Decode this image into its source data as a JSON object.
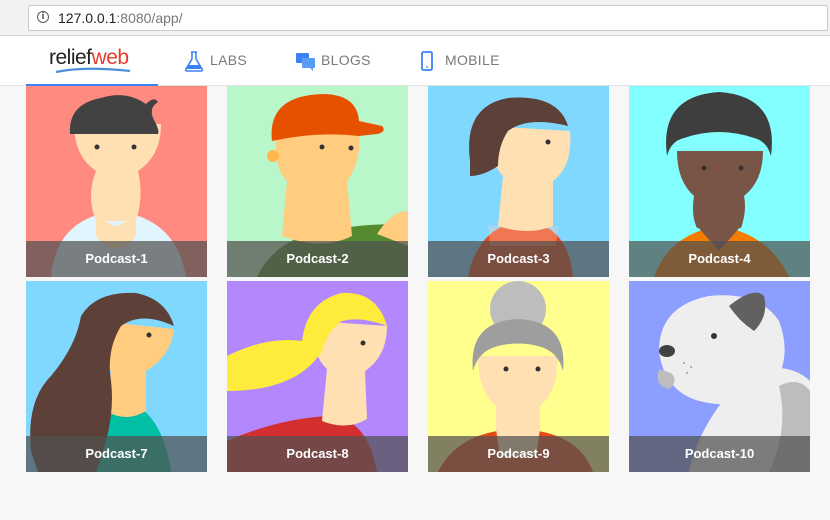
{
  "browser": {
    "url_host": "127.0.0.1",
    "url_rest": ":8080/app/"
  },
  "nav": {
    "logo_relief": "relief",
    "logo_web": "web",
    "items": [
      {
        "label": "LABS",
        "icon": "flask-icon"
      },
      {
        "label": "BLOGS",
        "icon": "chat-bubbles-icon"
      },
      {
        "label": "MOBILE",
        "icon": "mobile-phone-icon"
      }
    ]
  },
  "podcasts": [
    {
      "title": "Podcast-1",
      "bg": "#ff8a80"
    },
    {
      "title": "Podcast-2",
      "bg": "#b9f6ca"
    },
    {
      "title": "Podcast-3",
      "bg": "#80d8ff"
    },
    {
      "title": "Podcast-4",
      "bg": "#84ffff"
    },
    {
      "title": "Podcast-7",
      "bg": "#80d8ff"
    },
    {
      "title": "Podcast-8",
      "bg": "#b388ff"
    },
    {
      "title": "Podcast-9",
      "bg": "#ffff8d"
    },
    {
      "title": "Podcast-10",
      "bg": "#8c9eff"
    }
  ]
}
